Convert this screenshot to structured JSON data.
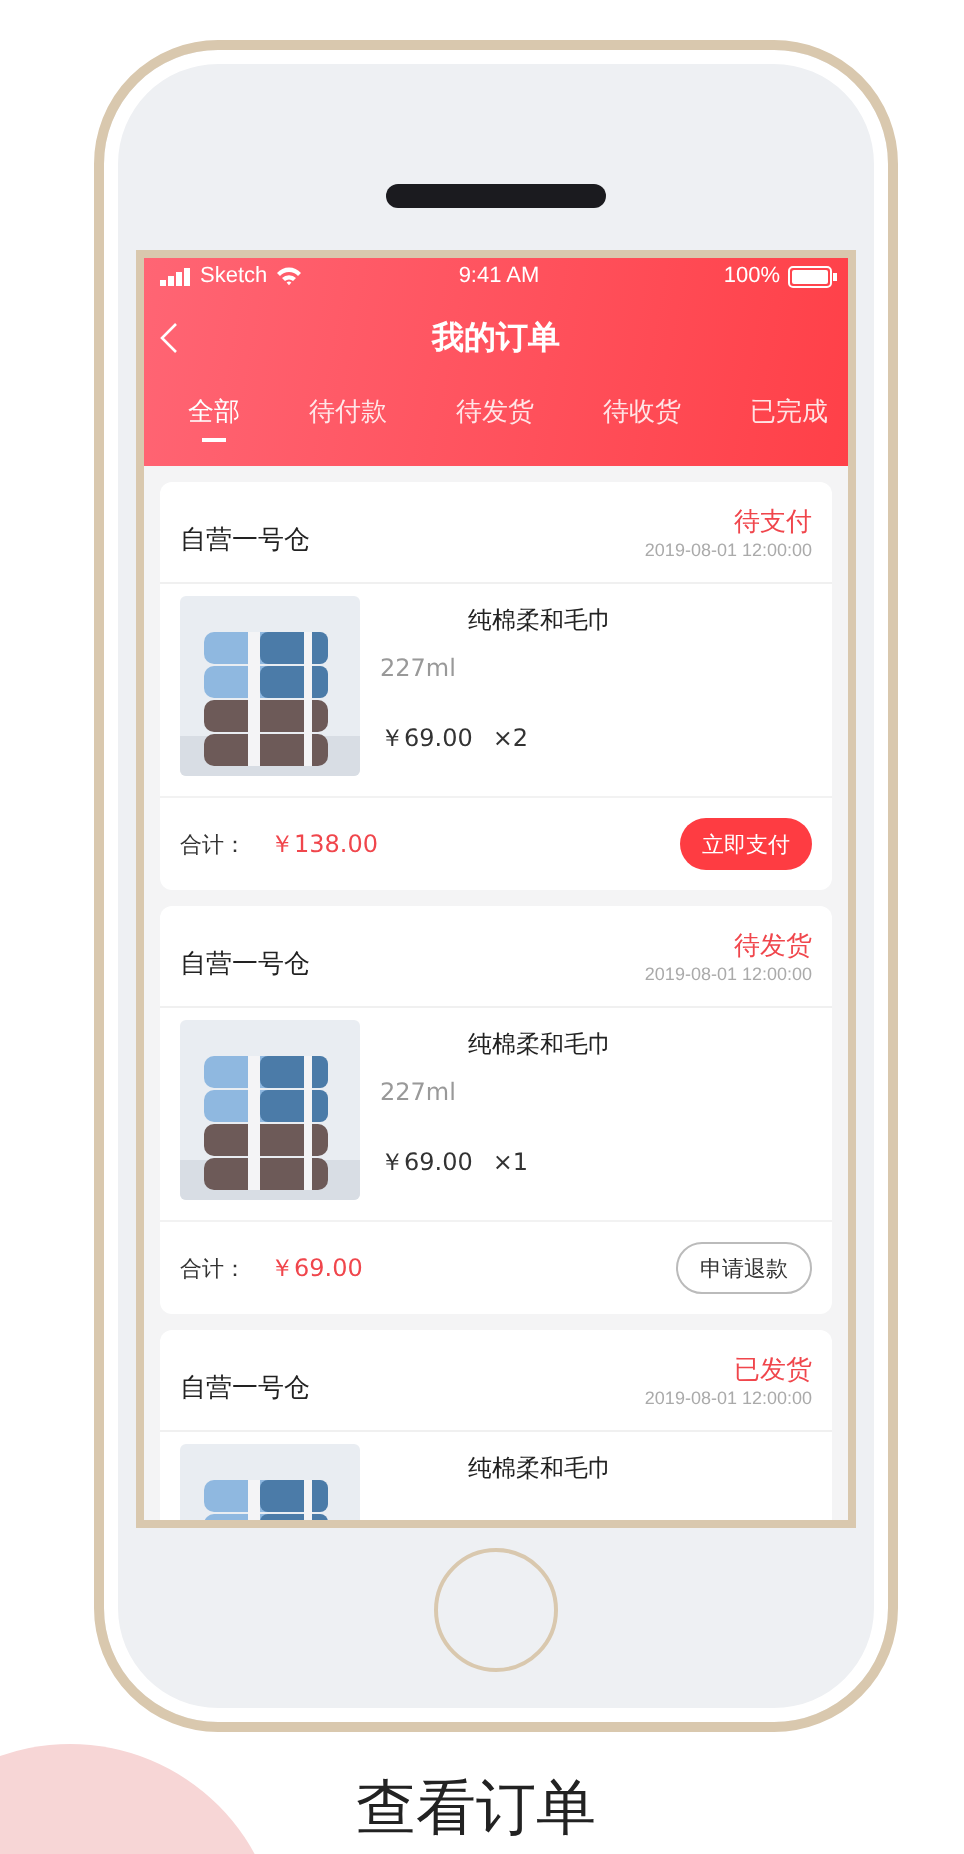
{
  "status_bar": {
    "carrier": "Sketch",
    "time": "9:41 AM",
    "battery": "100%"
  },
  "header": {
    "title": "我的订单"
  },
  "tabs": [
    {
      "label": "全部",
      "selected": true
    },
    {
      "label": "待付款",
      "selected": false
    },
    {
      "label": "待发货",
      "selected": false
    },
    {
      "label": "待收货",
      "selected": false
    },
    {
      "label": "已完成",
      "selected": false
    }
  ],
  "orders": [
    {
      "store": "自营一号仓",
      "status": "待支付",
      "time": "2019-08-01  12:00:00",
      "product": "纯棉柔和毛巾",
      "spec": "227ml",
      "price": "￥69.00",
      "quantity": "×2",
      "total_label": "合计：",
      "total": "￥138.00",
      "action": {
        "label": "立即支付",
        "kind": "primary"
      }
    },
    {
      "store": "自营一号仓",
      "status": "待发货",
      "time": "2019-08-01  12:00:00",
      "product": "纯棉柔和毛巾",
      "spec": "227ml",
      "price": "￥69.00",
      "quantity": "×1",
      "total_label": "合计：",
      "total": "￥69.00",
      "action": {
        "label": "申请退款",
        "kind": "outline"
      }
    },
    {
      "store": "自营一号仓",
      "status": "已发货",
      "time": "2019-08-01  12:00:00",
      "product": "纯棉柔和毛巾"
    }
  ],
  "caption": "查看订单"
}
